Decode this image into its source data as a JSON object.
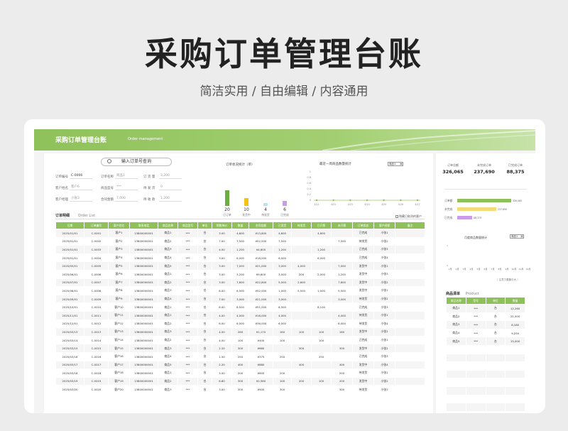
{
  "promo": {
    "title": "采购订单管理台账",
    "subtitle": "简洁实用 / 自由编辑 / 内容通用"
  },
  "banner": {
    "title": "采购订单管理台账",
    "subtitle_en": "Order management"
  },
  "search": {
    "label": "输入订单号查询"
  },
  "form": {
    "fields": [
      {
        "label": "订单编号",
        "value": "C-0006"
      },
      {
        "label": "订单名称",
        "value": "商品1"
      },
      {
        "label": "订 货 量",
        "value": "3,200"
      },
      {
        "label": "客户姓名",
        "value": "客户6"
      },
      {
        "label": "商品型号",
        "value": "***"
      },
      {
        "label": "待 发 货",
        "value": "0"
      },
      {
        "label": "客户经理",
        "value": "小张3"
      },
      {
        "label": "合同金额",
        "value": "7,000"
      },
      {
        "label": "待 收 款",
        "value": "1,200"
      }
    ]
  },
  "order_status": {
    "title": "订单状况统计（单）",
    "items": [
      {
        "label": "已订单",
        "value": "20",
        "color": "#6cae3e",
        "level": 20
      },
      {
        "label": "发货中",
        "value": "10",
        "color": "#f3c414",
        "level": 10
      },
      {
        "label": "待发货",
        "value": "4",
        "color": "#bfe0f3",
        "level": 4
      },
      {
        "label": "已完成",
        "value": "6",
        "color": "#c99be8",
        "level": 6
      }
    ]
  },
  "weekly_chart": {
    "title": "最近一周商品数量统计",
    "select_value": "商品1",
    "yticks": [
      "1",
      "0.8",
      "0.6",
      "0.4",
      "0.2",
      "0"
    ],
    "xticks": [
      "4/21",
      "4/22",
      "4/23",
      "4/24",
      "4/25",
      "4/26",
      "4/27"
    ]
  },
  "order_list": {
    "tab_cn": "订单明细",
    "tab_en": "Order List",
    "hide_option": "隐藏已取消的客户",
    "columns": [
      "日期",
      "订单编号",
      "客户姓名",
      "联系电话",
      "商品名称",
      "商品型号",
      "单位",
      "销售单价",
      "数量",
      "合同金额",
      "已发货",
      "待发货",
      "已开票",
      "未开票",
      "订单状态",
      "客户经理",
      "备注"
    ],
    "rows": [
      [
        "2025/01/01",
        "C-0001",
        "客户1",
        "13800000001",
        "商品1",
        "***",
        "台",
        "3.00",
        "4,600",
        "¥13,800",
        "4,600",
        "",
        "4,600",
        "",
        "已完成",
        "小张1",
        ""
      ],
      [
        "2025/01/01",
        "C-0002",
        "客户2",
        "13800000001",
        "商品2",
        "***",
        "台",
        "7.00",
        "7,500",
        "¥52,500",
        "7,500",
        "",
        "",
        "7,500",
        "待发货",
        "小张2",
        ""
      ],
      [
        "2025/01/01",
        "C-0003",
        "客户3",
        "13800000001",
        "商品3",
        "***",
        "台",
        "4.00",
        "1,200",
        "¥4,800",
        "1,200",
        "",
        "1,200",
        "",
        "已完成",
        "小张3",
        ""
      ],
      [
        "2025/01/01",
        "C-0004",
        "客户4",
        "13800000001",
        "商品4",
        "***",
        "台",
        "3.00",
        "6,000",
        "¥18,000",
        "6,000",
        "",
        "6,000",
        "",
        "已完成",
        "小张4",
        ""
      ],
      [
        "2025/05/01",
        "C-0005",
        "客户5",
        "13800000001",
        "商品5",
        "***",
        "台",
        "3.00",
        "7,000",
        "¥21,000",
        "3,000",
        "4,000",
        "",
        "7,000",
        "发货中",
        "小张1",
        ""
      ],
      [
        "2025/06/01",
        "C-0006",
        "客户6",
        "13800000001",
        "商品1",
        "***",
        "台",
        "3.00",
        "3,200",
        "¥9,600",
        "3,000",
        "200",
        "2,000",
        "1,200",
        "发货中",
        "小张3",
        ""
      ],
      [
        "2025/07/01",
        "C-0007",
        "客户7",
        "13800000001",
        "商品2",
        "***",
        "台",
        "3.00",
        "7,600",
        "¥22,800",
        "5,000",
        "2,600",
        "",
        "7,600",
        "发货中",
        "小张2",
        ""
      ],
      [
        "2025/08/01",
        "C-0008",
        "客户8",
        "13800000001",
        "商品3",
        "***",
        "台",
        "8.00",
        "6,500",
        "¥52,000",
        "1,000",
        "5,500",
        "1,000",
        "5,500",
        "发货中",
        "小张1",
        ""
      ],
      [
        "2025/09/01",
        "C-0009",
        "客户9",
        "13800000001",
        "商品4",
        "***",
        "台",
        "7.00",
        "3,000",
        "¥21,000",
        "3,000",
        "",
        "",
        "3,000",
        "待发货",
        "小张2",
        ""
      ],
      [
        "2025/10/01",
        "C-0010",
        "客户10",
        "13800000001",
        "商品1",
        "***",
        "台",
        "6.00",
        "8,500",
        "¥51,000",
        "8,500",
        "",
        "8,100",
        "",
        "已完成",
        "小张3",
        ""
      ],
      [
        "2025/11/01",
        "C-0011",
        "客户11",
        "13800000001",
        "商品1",
        "***",
        "台",
        "4.00",
        "4,000",
        "¥16,000",
        "4,000",
        "",
        "",
        "4,000",
        "待发货",
        "小张1",
        ""
      ],
      [
        "2025/12/01",
        "C-0012",
        "客户12",
        "13800000001",
        "商品2",
        "***",
        "台",
        "6.00",
        "6,000",
        "¥36,000",
        "6,000",
        "",
        "",
        "6,000",
        "待发货",
        "小张4",
        ""
      ],
      [
        "2025/03/13",
        "C-0013",
        "客户13",
        "13800000001",
        "商品3",
        "***",
        "台",
        "4.50",
        "260",
        "¥1,170",
        "160",
        "100",
        "100",
        "160",
        "发货中",
        "小张2",
        ""
      ],
      [
        "2025/03/14",
        "C-0014",
        "客户14",
        "13800000001",
        "商品2",
        "***",
        "台",
        "4.00",
        "100",
        "¥400",
        "100",
        "",
        "100",
        "",
        "已完成",
        "小张1",
        ""
      ],
      [
        "2025/03/15",
        "C-0015",
        "客户15",
        "13800000001",
        "商品3",
        "***",
        "台",
        "2.20",
        "300",
        "¥660",
        "",
        "300",
        "",
        "300",
        "发货中",
        "小张2",
        ""
      ],
      [
        "2025/03/16",
        "C-0016",
        "客户16",
        "13800000001",
        "商品4",
        "***",
        "台",
        "1.50",
        "250",
        "¥375",
        "250",
        "",
        "250",
        "",
        "已完成",
        "小张3",
        ""
      ],
      [
        "2025/03/17",
        "C-0017",
        "客户17",
        "13800000001",
        "商品5",
        "***",
        "台",
        "2.20",
        "400",
        "¥880",
        "",
        "400",
        "",
        "400",
        "发货中",
        "小张4",
        ""
      ],
      [
        "2025/03/18",
        "C-0018",
        "客户18",
        "13800000001",
        "商品1",
        "***",
        "台",
        "3.00",
        "200",
        "¥600",
        "200",
        "",
        "",
        "200",
        "待发货",
        "小张1",
        ""
      ],
      [
        "2025/03/19",
        "C-0019",
        "客户19",
        "13800000001",
        "商品2",
        "***",
        "台",
        "8.60",
        "300",
        "¥2,580",
        "100",
        "200",
        "100",
        "200",
        "发货中",
        "小张2",
        ""
      ],
      [
        "2025/03/20",
        "C-0020",
        "客户20",
        "13800000001",
        "商品3",
        "***",
        "台",
        "3.00",
        "300",
        "¥900",
        "300",
        "",
        "",
        "300",
        "待发货",
        "小张3",
        ""
      ]
    ]
  },
  "kpis": [
    {
      "label": "订单总额",
      "value": "326,065"
    },
    {
      "label": "未完成订单",
      "value": "237,690"
    },
    {
      "label": "已完成订单",
      "value": "88,375"
    }
  ],
  "amount_bars": [
    {
      "label": "订单额",
      "value": "326,065",
      "color": "#8fc15a",
      "fraction": 1.0
    },
    {
      "label": "未完成",
      "value": "237,690",
      "color": "#f3db7a",
      "fraction": 0.729
    },
    {
      "label": "已完成",
      "value": "88,375",
      "color": "#c99be8",
      "fraction": 0.271
    }
  ],
  "monthly_chart": {
    "title": "月度商品数量统计",
    "select_value": "商品1",
    "yticks": [
      "1",
      "0"
    ],
    "xticks": [
      "1月",
      "2月",
      "3月",
      "4月",
      "5月",
      "6月",
      "7月",
      "8月",
      "9月",
      "10月",
      "11月",
      "12月"
    ],
    "note": "（ 注意力要集中大 ）"
  },
  "products": {
    "tab_cn": "商品清单",
    "tab_en": "Product",
    "columns": [
      "商品名称",
      "型号",
      "单位",
      "数量"
    ],
    "rows": [
      [
        "商品1",
        "***",
        "台",
        "12,260"
      ],
      [
        "商品2",
        "***",
        "台",
        "21,500"
      ],
      [
        "商品3",
        "***",
        "台",
        "8,180"
      ],
      [
        "商品4",
        "***",
        "台",
        "9,250"
      ],
      [
        "商品5",
        "***",
        "台",
        "15,000"
      ]
    ]
  }
}
